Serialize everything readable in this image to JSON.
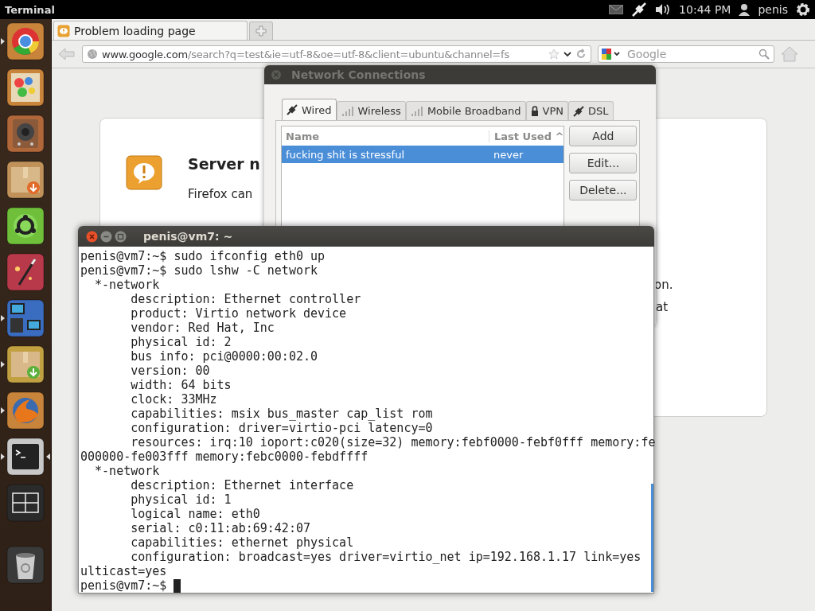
{
  "top_panel": {
    "app_title": "Terminal",
    "time": "10:44 PM",
    "user": "penis"
  },
  "launcher": [
    {
      "kind": "browser",
      "running": true,
      "focused": false
    },
    {
      "kind": "paint",
      "running": false,
      "focused": false
    },
    {
      "kind": "speaker",
      "running": false,
      "focused": false
    },
    {
      "kind": "package",
      "running": false,
      "focused": false
    },
    {
      "kind": "ring",
      "running": false,
      "focused": false
    },
    {
      "kind": "wand",
      "running": false,
      "focused": false
    },
    {
      "kind": "computer",
      "running": true,
      "focused": false
    },
    {
      "kind": "download",
      "running": true,
      "focused": false
    },
    {
      "kind": "globe",
      "running": true,
      "focused": false
    },
    {
      "kind": "terminal",
      "running": true,
      "focused": true
    },
    {
      "kind": "workspaces",
      "running": false,
      "focused": false
    },
    {
      "kind": "trash",
      "running": false,
      "focused": false
    }
  ],
  "browser": {
    "tab": {
      "title": "Problem loading page"
    },
    "url": {
      "host": "www.google.com",
      "path": "/search?q=test&ie=utf-8&oe=utf-8&client=ubuntu&channel=fs"
    },
    "search": {
      "placeholder": "Google"
    },
    "error": {
      "title": "Server n",
      "text": "Firefox can",
      "fragment_1": "on.",
      "fragment_2": "at"
    }
  },
  "network_dialog": {
    "title": "Network Connections",
    "tabs": [
      {
        "label": "Wired",
        "kind": "plug",
        "selected": true
      },
      {
        "label": "Wireless",
        "kind": "bars",
        "selected": false
      },
      {
        "label": "Mobile Broadband",
        "kind": "bars",
        "selected": false
      },
      {
        "label": "VPN",
        "kind": "lock",
        "selected": false
      },
      {
        "label": "DSL",
        "kind": "plug",
        "selected": false
      }
    ],
    "columns": [
      "Name",
      "Last Used ^"
    ],
    "rows": [
      {
        "name": "fucking shit is stressful",
        "last_used": "never",
        "selected": true
      }
    ],
    "buttons": [
      "Add",
      "Edit...",
      "Delete..."
    ]
  },
  "terminal": {
    "title": "penis@vm7: ~",
    "lines": [
      "penis@vm7:~$ sudo ifconfig eth0 up",
      "penis@vm7:~$ sudo lshw -C network",
      "  *-network",
      "       description: Ethernet controller",
      "       product: Virtio network device",
      "       vendor: Red Hat, Inc",
      "       physical id: 2",
      "       bus info: pci@0000:00:02.0",
      "       version: 00",
      "       width: 64 bits",
      "       clock: 33MHz",
      "       capabilities: msix bus_master cap_list rom",
      "       configuration: driver=virtio-pci latency=0",
      "       resources: irq:10 ioport:c020(size=32) memory:febf0000-febf0fff memory:fe",
      "000000-fe003fff memory:febc0000-febdffff",
      "  *-network",
      "       description: Ethernet interface",
      "       physical id: 1",
      "       logical name: eth0",
      "       serial: c0:11:ab:69:42:07",
      "       capabilities: ethernet physical",
      "       configuration: broadcast=yes driver=virtio_net ip=192.168.1.17 link=yes",
      "ulticast=yes"
    ],
    "prompt": "penis@vm7:~$"
  }
}
